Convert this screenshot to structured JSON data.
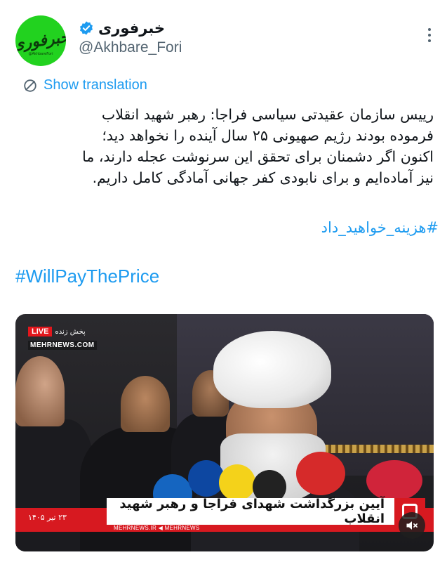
{
  "author": {
    "display_name": "خبرفوری",
    "handle": "@Akhbare_Fori",
    "verified": true,
    "avatar_text": "خبرفوری",
    "avatar_sub": "@AkhbareFori"
  },
  "translate": {
    "label": "Show translation",
    "icon": "globe-icon"
  },
  "tweet": {
    "lines": [
      "رییس سازمان عقیدتی سیاسی فراجا: رهبر شهید انقلاب",
      "فرموده بودند رژیم صهیونی ۲۵ سال آینده را نخواهد دید؛",
      "اکنون اگر دشمنان برای تحقق این سرنوشت عجله دارند، ما",
      "نیز آماده‌ایم و برای نابودی کفر جهانی آمادگی کامل داریم."
    ],
    "hashtag_fa": "#هزینه_خواهید_داد",
    "hashtag_en": "#WillPayThePrice"
  },
  "media": {
    "live_label": "LIVE",
    "live_fa": "پخش زنده",
    "channel_url": "MEHRNEWS.COM",
    "headline": "آیین بزرگداشت شهدای فراجا و رهبر شهید انقلاب",
    "date": "۲۳ تیر ۱۴۰۵",
    "footer_sites": "MEHRNEWS.IR   ◀ MEHRNEWS",
    "mute_icon": "speaker-muted-icon"
  },
  "colors": {
    "accent": "#1d9bf0",
    "avatar_bg": "#22d21f",
    "ticker_red": "#d71920"
  }
}
